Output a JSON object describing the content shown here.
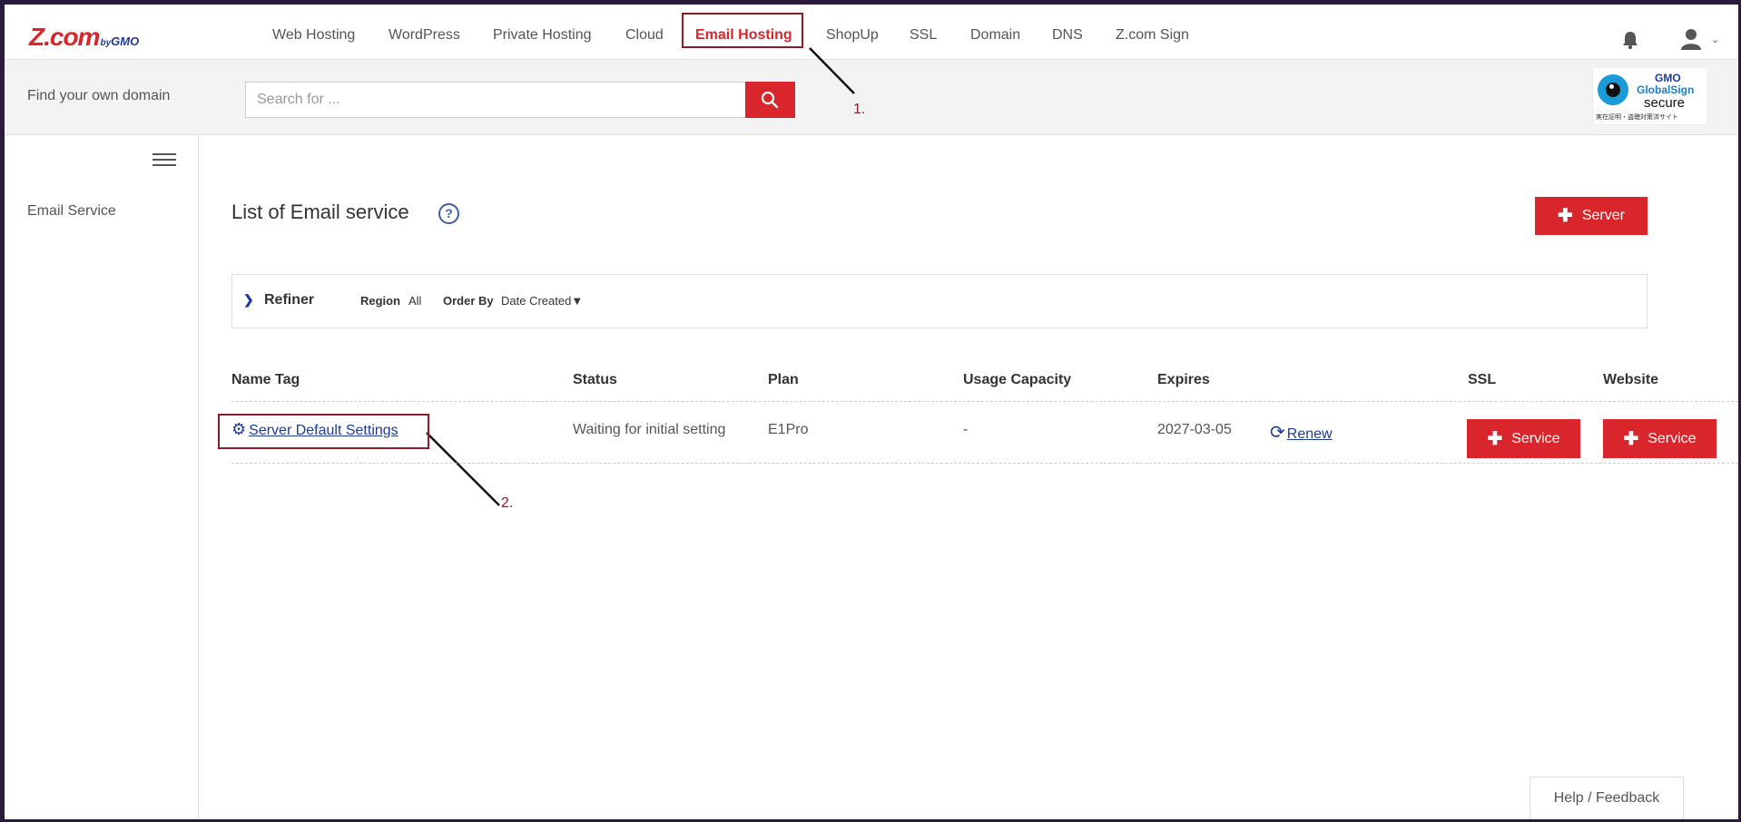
{
  "brand": {
    "logo_main": "Z.com",
    "logo_by": "by",
    "logo_gmo": "GMO"
  },
  "nav": {
    "items": [
      "Web Hosting",
      "WordPress",
      "Private Hosting",
      "Cloud",
      "Email Hosting",
      "ShopUp",
      "SSL",
      "Domain",
      "DNS",
      "Z.com Sign"
    ],
    "active": "Email Hosting"
  },
  "search": {
    "label": "Find your own domain",
    "placeholder": "Search for ..."
  },
  "badge": {
    "line1": "GMO",
    "line2": "GlobalSign",
    "line3": "secure",
    "line4": "実在証明・盗聴対策済サイト"
  },
  "sidebar": {
    "items": [
      {
        "label": "Email Service"
      }
    ]
  },
  "main": {
    "title": "List of Email service",
    "add_button": "Server",
    "refiner": {
      "label": "Refiner",
      "region_label": "Region",
      "region_value": "All",
      "order_label": "Order By",
      "order_value": "Date Created▼"
    },
    "table": {
      "headers": [
        "Name Tag",
        "Status",
        "Plan",
        "Usage Capacity",
        "Expires",
        "SSL",
        "Website"
      ],
      "rows": [
        {
          "name": "Server Default Settings",
          "status": "Waiting for initial setting",
          "plan": "E1Pro",
          "usage": "-",
          "expires": "2027-03-05",
          "renew": "Renew",
          "ssl_button": "Service",
          "website_button": "Service"
        }
      ]
    }
  },
  "annotations": {
    "step1": "1.",
    "step2": "2."
  },
  "footer": {
    "feedback": "Help / Feedback"
  },
  "colors": {
    "brand_red": "#d9262c",
    "link_blue": "#1f3a93",
    "annotation": "#8a1d2a"
  }
}
